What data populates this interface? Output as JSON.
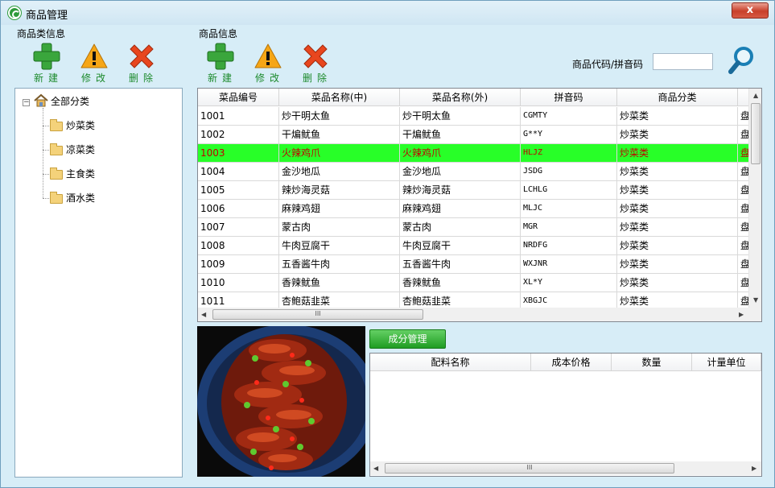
{
  "window": {
    "title": "商品管理",
    "close_symbol": "x"
  },
  "categories_panel": {
    "title": "商品类信息",
    "toolbar": {
      "new_label": "新建",
      "edit_label": "修改",
      "delete_label": "删除"
    },
    "tree": {
      "root": "全部分类",
      "children": [
        "炒菜类",
        "凉菜类",
        "主食类",
        "酒水类"
      ]
    }
  },
  "products_panel": {
    "title": "商品信息",
    "toolbar": {
      "new_label": "新建",
      "edit_label": "修改",
      "delete_label": "删除"
    },
    "search": {
      "label": "商品代码/拼音码",
      "value": ""
    },
    "table": {
      "columns": [
        "菜品编号",
        "菜品名称(中)",
        "菜品名称(外)",
        "拼音码",
        "商品分类"
      ],
      "rows": [
        [
          "1001",
          "炒干明太鱼",
          "炒干明太鱼",
          "CGMTY",
          "炒菜类",
          "盘"
        ],
        [
          "1002",
          "干煸鱿鱼",
          "干煸鱿鱼",
          "G**Y",
          "炒菜类",
          "盘"
        ],
        [
          "1003",
          "火辣鸡爪",
          "火辣鸡爪",
          "HLJZ",
          "炒菜类",
          "盘"
        ],
        [
          "1004",
          "金沙地瓜",
          "金沙地瓜",
          "JSDG",
          "炒菜类",
          "盘"
        ],
        [
          "1005",
          "辣炒海灵菇",
          "辣炒海灵菇",
          "LCHLG",
          "炒菜类",
          "盘"
        ],
        [
          "1006",
          "麻辣鸡翅",
          "麻辣鸡翅",
          "MLJC",
          "炒菜类",
          "盘"
        ],
        [
          "1007",
          "蒙古肉",
          "蒙古肉",
          "MGR",
          "炒菜类",
          "盘"
        ],
        [
          "1008",
          "牛肉豆腐干",
          "牛肉豆腐干",
          "NRDFG",
          "炒菜类",
          "盘"
        ],
        [
          "1009",
          "五香酱牛肉",
          "五香酱牛肉",
          "WXJNR",
          "炒菜类",
          "盘"
        ],
        [
          "1010",
          "香辣鱿鱼",
          "香辣鱿鱼",
          "XL*Y",
          "炒菜类",
          "盘"
        ],
        [
          "1011",
          "杏鲍菇韭菜",
          "杏鲍菇韭菜",
          "XBGJC",
          "炒菜类",
          "盘"
        ]
      ],
      "selected_row": 2
    }
  },
  "ingredients": {
    "button_label": "成分管理",
    "columns": [
      "配料名称",
      "成本价格",
      "数量",
      "计量单位"
    ],
    "rows": []
  },
  "scroll_glyph": "III",
  "colors": {
    "selected_row": "#28ff28",
    "selected_text": "#c00000",
    "toolbar_label": "#1c8a2c"
  }
}
